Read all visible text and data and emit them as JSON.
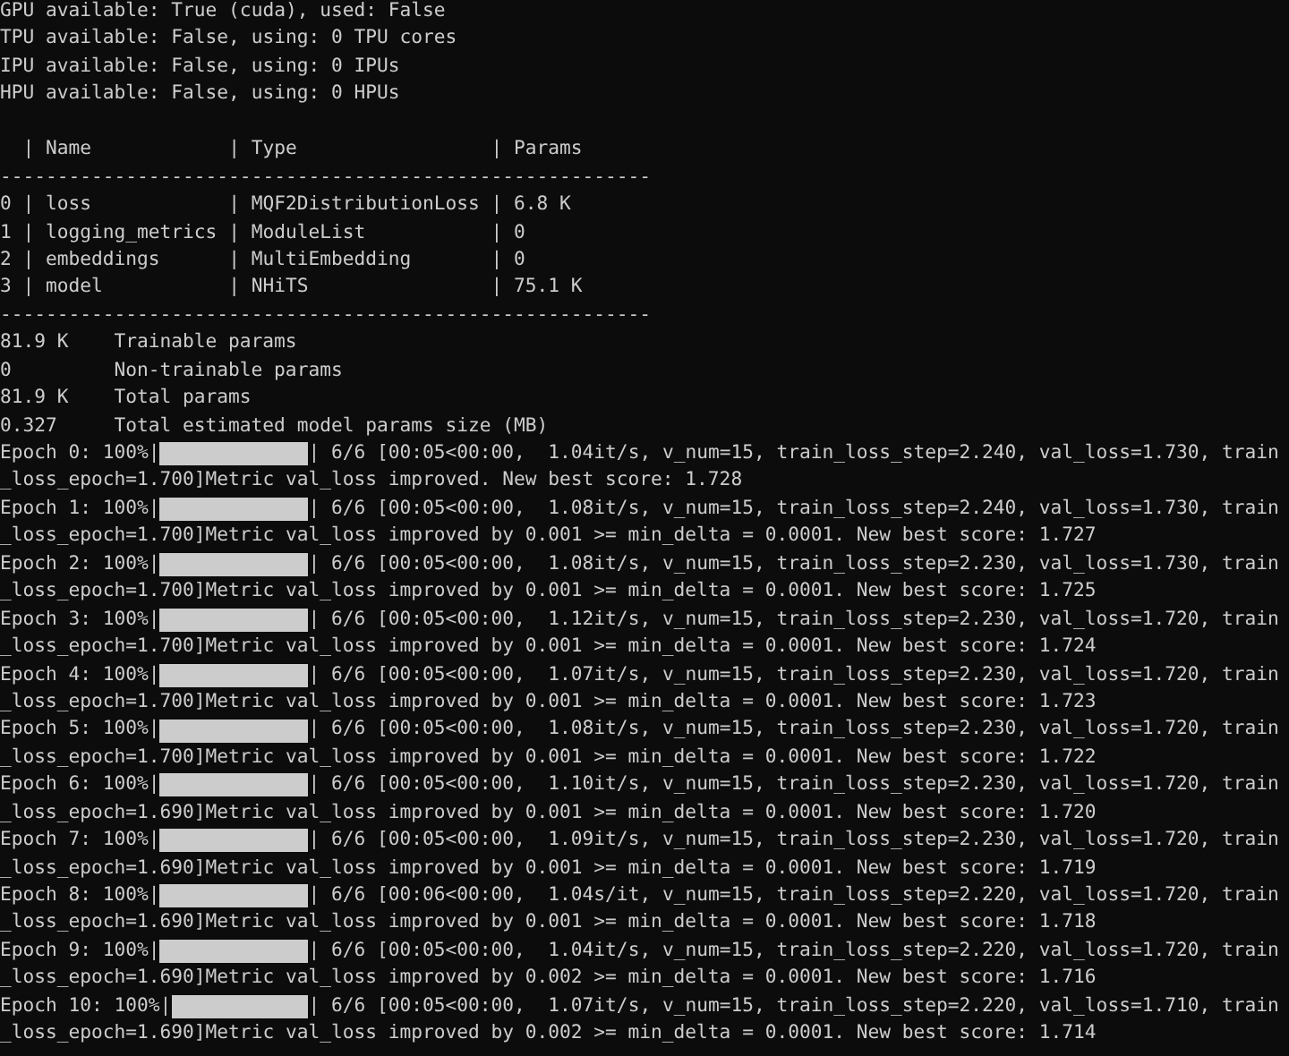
{
  "header_lines": [
    "GPU available: True (cuda), used: False",
    "TPU available: False, using: 0 TPU cores",
    "IPU available: False, using: 0 IPUs",
    "HPU available: False, using: 0 HPUs"
  ],
  "table": {
    "divider": "|",
    "rule": "---------------------------------------------------------",
    "columns": [
      "Name",
      "Type",
      "Params"
    ],
    "rows": [
      {
        "index": "0",
        "cells": [
          "loss",
          "MQF2DistributionLoss",
          "6.8 K"
        ]
      },
      {
        "index": "1",
        "cells": [
          "logging_metrics",
          "ModuleList",
          "0"
        ]
      },
      {
        "index": "2",
        "cells": [
          "embeddings",
          "MultiEmbedding",
          "0"
        ]
      },
      {
        "index": "3",
        "cells": [
          "model",
          "NHiTS",
          "75.1 K"
        ]
      }
    ]
  },
  "summary": [
    {
      "value": "81.9 K",
      "label": "Trainable params"
    },
    {
      "value": "0",
      "label": "Non-trainable params"
    },
    {
      "value": "81.9 K",
      "label": "Total params"
    },
    {
      "value": "0.327",
      "label": "Total estimated model params size (MB)"
    }
  ],
  "bar_edge": "|",
  "epochs": [
    {
      "label": "Epoch 0: 100%",
      "level": 1,
      "stats": " 6/6 [00:05<00:00,  1.04it/s, v_num=15, train_loss_step=2.240, val_loss=1.730, train",
      "message": "_loss_epoch=1.700]Metric val_loss improved. New best score: 1.728"
    },
    {
      "label": "Epoch 1: 100%",
      "level": 1,
      "stats": " 6/6 [00:05<00:00,  1.08it/s, v_num=15, train_loss_step=2.240, val_loss=1.730, train",
      "message": "_loss_epoch=1.700]Metric val_loss improved by 0.001 >= min_delta = 0.0001. New best score: 1.727"
    },
    {
      "label": "Epoch 2: 100%",
      "level": 1,
      "stats": " 6/6 [00:05<00:00,  1.08it/s, v_num=15, train_loss_step=2.230, val_loss=1.730, train",
      "message": "_loss_epoch=1.700]Metric val_loss improved by 0.001 >= min_delta = 0.0001. New best score: 1.725"
    },
    {
      "label": "Epoch 3: 100%",
      "level": 1,
      "stats": " 6/6 [00:05<00:00,  1.12it/s, v_num=15, train_loss_step=2.230, val_loss=1.720, train",
      "message": "_loss_epoch=1.700]Metric val_loss improved by 0.001 >= min_delta = 0.0001. New best score: 1.724"
    },
    {
      "label": "Epoch 4: 100%",
      "level": 1,
      "stats": " 6/6 [00:05<00:00,  1.07it/s, v_num=15, train_loss_step=2.230, val_loss=1.720, train",
      "message": "_loss_epoch=1.700]Metric val_loss improved by 0.001 >= min_delta = 0.0001. New best score: 1.723"
    },
    {
      "label": "Epoch 5: 100%",
      "level": 1,
      "stats": " 6/6 [00:05<00:00,  1.08it/s, v_num=15, train_loss_step=2.230, val_loss=1.720, train",
      "message": "_loss_epoch=1.700]Metric val_loss improved by 0.001 >= min_delta = 0.0001. New best score: 1.722"
    },
    {
      "label": "Epoch 6: 100%",
      "level": 1,
      "stats": " 6/6 [00:05<00:00,  1.10it/s, v_num=15, train_loss_step=2.230, val_loss=1.720, train",
      "message": "_loss_epoch=1.690]Metric val_loss improved by 0.001 >= min_delta = 0.0001. New best score: 1.720"
    },
    {
      "label": "Epoch 7: 100%",
      "level": 1,
      "stats": " 6/6 [00:05<00:00,  1.09it/s, v_num=15, train_loss_step=2.230, val_loss=1.720, train",
      "message": "_loss_epoch=1.690]Metric val_loss improved by 0.001 >= min_delta = 0.0001. New best score: 1.719"
    },
    {
      "label": "Epoch 8: 100%",
      "level": 1,
      "stats": " 6/6 [00:06<00:00,  1.04s/it, v_num=15, train_loss_step=2.220, val_loss=1.720, train",
      "message": "_loss_epoch=1.690]Metric val_loss improved by 0.001 >= min_delta = 0.0001. New best score: 1.718"
    },
    {
      "label": "Epoch 9: 100%",
      "level": 1,
      "stats": " 6/6 [00:05<00:00,  1.04it/s, v_num=15, train_loss_step=2.220, val_loss=1.720, train",
      "message": "_loss_epoch=1.690]Metric val_loss improved by 0.002 >= min_delta = 0.0001. New best score: 1.716"
    },
    {
      "label": "Epoch 10: 100%",
      "level": 1,
      "stats": " 6/6 [00:05<00:00,  1.07it/s, v_num=15, train_loss_step=2.220, val_loss=1.710, train",
      "message": "_loss_epoch=1.690]Metric val_loss improved by 0.002 >= min_delta = 0.0001. New best score: 1.714"
    }
  ]
}
